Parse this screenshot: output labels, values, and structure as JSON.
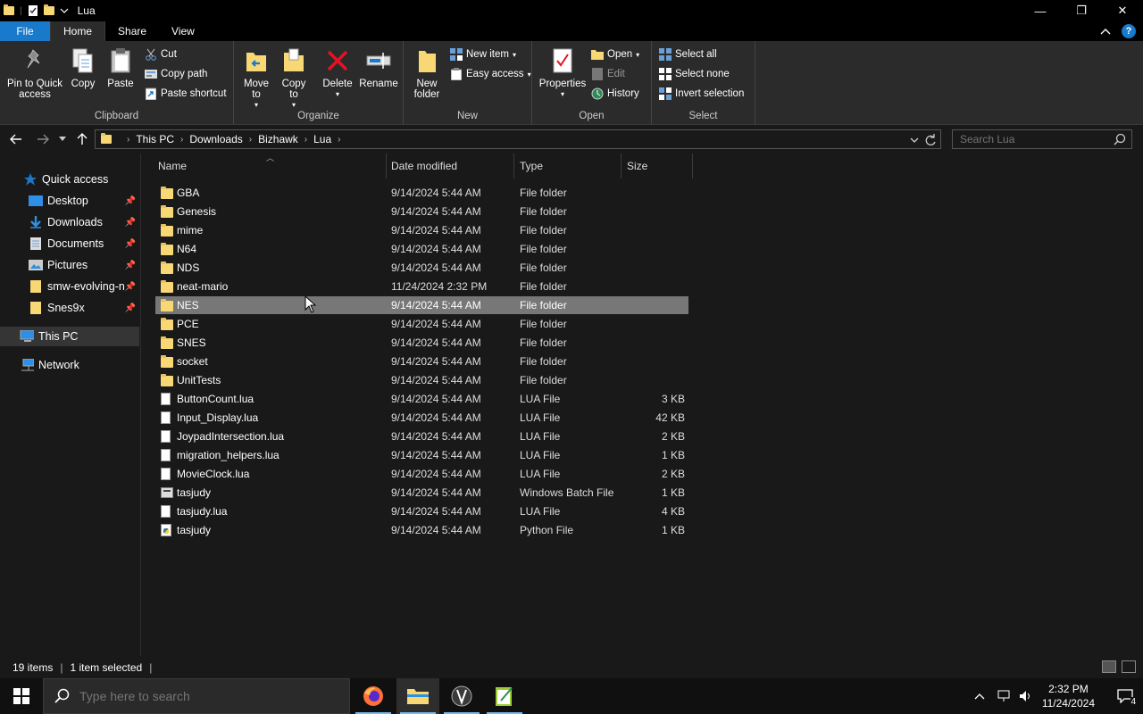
{
  "window": {
    "title": "Lua",
    "minimize": "—",
    "maximize": "❐",
    "close": "✕"
  },
  "tabs": [
    {
      "label": "File"
    },
    {
      "label": "Home"
    },
    {
      "label": "Share"
    },
    {
      "label": "View"
    }
  ],
  "ribbon": {
    "clipboard": {
      "label": "Clipboard",
      "pin": "Pin to Quick access",
      "copy": "Copy",
      "paste": "Paste",
      "cut": "Cut",
      "copy_path": "Copy path",
      "paste_shortcut": "Paste shortcut"
    },
    "organize": {
      "label": "Organize",
      "move_to": "Move to",
      "copy_to": "Copy to",
      "delete": "Delete",
      "rename": "Rename"
    },
    "new": {
      "label": "New",
      "new_folder": "New folder",
      "new_item": "New item",
      "easy_access": "Easy access"
    },
    "open": {
      "label": "Open",
      "properties": "Properties",
      "open": "Open",
      "edit": "Edit",
      "history": "History"
    },
    "select": {
      "label": "Select",
      "select_all": "Select all",
      "select_none": "Select none",
      "invert": "Invert selection"
    }
  },
  "address": {
    "crumbs": [
      "This PC",
      "Downloads",
      "Bizhawk",
      "Lua"
    ],
    "search_placeholder": "Search Lua"
  },
  "nav": {
    "quick_access": "Quick access",
    "items": [
      {
        "label": "Desktop"
      },
      {
        "label": "Downloads"
      },
      {
        "label": "Documents"
      },
      {
        "label": "Pictures"
      },
      {
        "label": "smw-evolving-n"
      },
      {
        "label": "Snes9x"
      }
    ],
    "this_pc": "This PC",
    "network": "Network"
  },
  "columns": {
    "name": "Name",
    "date": "Date modified",
    "type": "Type",
    "size": "Size"
  },
  "files": [
    {
      "name": "GBA",
      "date": "9/14/2024 5:44 AM",
      "type": "File folder",
      "size": "",
      "kind": "folder"
    },
    {
      "name": "Genesis",
      "date": "9/14/2024 5:44 AM",
      "type": "File folder",
      "size": "",
      "kind": "folder"
    },
    {
      "name": "mime",
      "date": "9/14/2024 5:44 AM",
      "type": "File folder",
      "size": "",
      "kind": "folder"
    },
    {
      "name": "N64",
      "date": "9/14/2024 5:44 AM",
      "type": "File folder",
      "size": "",
      "kind": "folder"
    },
    {
      "name": "NDS",
      "date": "9/14/2024 5:44 AM",
      "type": "File folder",
      "size": "",
      "kind": "folder"
    },
    {
      "name": "neat-mario",
      "date": "11/24/2024 2:32 PM",
      "type": "File folder",
      "size": "",
      "kind": "folder"
    },
    {
      "name": "NES",
      "date": "9/14/2024 5:44 AM",
      "type": "File folder",
      "size": "",
      "kind": "folder"
    },
    {
      "name": "PCE",
      "date": "9/14/2024 5:44 AM",
      "type": "File folder",
      "size": "",
      "kind": "folder"
    },
    {
      "name": "SNES",
      "date": "9/14/2024 5:44 AM",
      "type": "File folder",
      "size": "",
      "kind": "folder"
    },
    {
      "name": "socket",
      "date": "9/14/2024 5:44 AM",
      "type": "File folder",
      "size": "",
      "kind": "folder"
    },
    {
      "name": "UnitTests",
      "date": "9/14/2024 5:44 AM",
      "type": "File folder",
      "size": "",
      "kind": "folder"
    },
    {
      "name": "ButtonCount.lua",
      "date": "9/14/2024 5:44 AM",
      "type": "LUA File",
      "size": "3 KB",
      "kind": "file"
    },
    {
      "name": "Input_Display.lua",
      "date": "9/14/2024 5:44 AM",
      "type": "LUA File",
      "size": "42 KB",
      "kind": "file"
    },
    {
      "name": "JoypadIntersection.lua",
      "date": "9/14/2024 5:44 AM",
      "type": "LUA File",
      "size": "2 KB",
      "kind": "file"
    },
    {
      "name": "migration_helpers.lua",
      "date": "9/14/2024 5:44 AM",
      "type": "LUA File",
      "size": "1 KB",
      "kind": "file"
    },
    {
      "name": "MovieClock.lua",
      "date": "9/14/2024 5:44 AM",
      "type": "LUA File",
      "size": "2 KB",
      "kind": "file"
    },
    {
      "name": "tasjudy",
      "date": "9/14/2024 5:44 AM",
      "type": "Windows Batch File",
      "size": "1 KB",
      "kind": "bat"
    },
    {
      "name": "tasjudy.lua",
      "date": "9/14/2024 5:44 AM",
      "type": "LUA File",
      "size": "4 KB",
      "kind": "file"
    },
    {
      "name": "tasjudy",
      "date": "9/14/2024 5:44 AM",
      "type": "Python File",
      "size": "1 KB",
      "kind": "py"
    }
  ],
  "selected_index": 6,
  "status": {
    "count": "19 items",
    "selection": "1 item selected"
  },
  "taskbar": {
    "search_placeholder": "Type here to search",
    "time": "2:32 PM",
    "date": "11/24/2024",
    "notification_count": "4"
  },
  "colors": {
    "accent": "#1979ca",
    "folder": "#f8d775",
    "selected_row": "#777777"
  }
}
